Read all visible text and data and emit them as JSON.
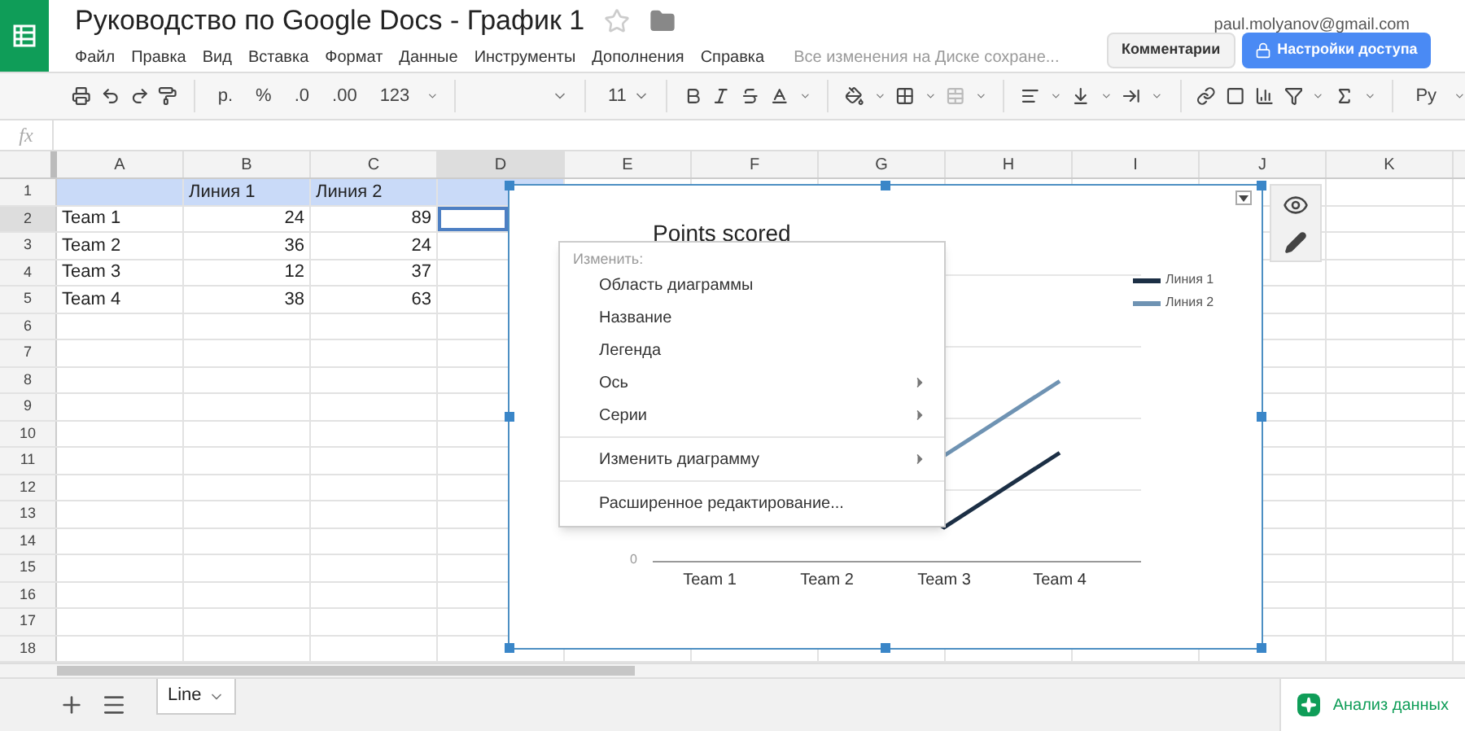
{
  "header": {
    "title": "Руководство по Google Docs - График 1",
    "account": "paul.molyanov@gmail.com",
    "save_status": "Все изменения на Диске сохране...",
    "comments_button": "Комментарии",
    "share_button": "Настройки доступа"
  },
  "menu": [
    "Файл",
    "Правка",
    "Вид",
    "Вставка",
    "Формат",
    "Данные",
    "Инструменты",
    "Дополнения",
    "Справка"
  ],
  "toolbar": {
    "currency": "р.",
    "percent": "%",
    "decrease_decimals": ".0",
    "increase_decimals": ".00",
    "more_formats": "123",
    "font_size": "11",
    "input_tools": "Ру"
  },
  "formula_bar": {
    "label": "fx"
  },
  "sheet": {
    "columns": [
      {
        "label": "A",
        "selected": false
      },
      {
        "label": "B",
        "selected": false
      },
      {
        "label": "C",
        "selected": false
      },
      {
        "label": "D",
        "selected": true
      },
      {
        "label": "E",
        "selected": false
      },
      {
        "label": "F",
        "selected": false
      },
      {
        "label": "G",
        "selected": false
      },
      {
        "label": "H",
        "selected": false
      },
      {
        "label": "I",
        "selected": false
      },
      {
        "label": "J",
        "selected": false
      },
      {
        "label": "K",
        "selected": false
      }
    ],
    "rows": [
      {
        "number": "1",
        "selected": false,
        "highlight": true,
        "cells": {
          "b": "Линия 1",
          "c": "Линия 2"
        }
      },
      {
        "number": "2",
        "selected": true,
        "highlight": false,
        "cells": {
          "a": "Team 1",
          "b": "24",
          "c": "89"
        }
      },
      {
        "number": "3",
        "selected": false,
        "highlight": false,
        "cells": {
          "a": "Team 2",
          "b": "36",
          "c": "24"
        }
      },
      {
        "number": "4",
        "selected": false,
        "highlight": false,
        "cells": {
          "a": "Team 3",
          "b": "12",
          "c": "37"
        }
      },
      {
        "number": "5",
        "selected": false,
        "highlight": false,
        "cells": {
          "a": "Team 4",
          "b": "38",
          "c": "63"
        }
      },
      {
        "number": "6",
        "selected": false,
        "highlight": false
      },
      {
        "number": "7",
        "selected": false,
        "highlight": false
      },
      {
        "number": "8",
        "selected": false,
        "highlight": false
      },
      {
        "number": "9",
        "selected": false,
        "highlight": false
      },
      {
        "number": "10",
        "selected": false,
        "highlight": false
      },
      {
        "number": "11",
        "selected": false,
        "highlight": false
      },
      {
        "number": "12",
        "selected": false,
        "highlight": false
      },
      {
        "number": "13",
        "selected": false,
        "highlight": false
      },
      {
        "number": "14",
        "selected": false,
        "highlight": false
      },
      {
        "number": "15",
        "selected": false,
        "highlight": false
      },
      {
        "number": "16",
        "selected": false,
        "highlight": false
      },
      {
        "number": "17",
        "selected": false,
        "highlight": false
      },
      {
        "number": "18",
        "selected": false,
        "highlight": false
      }
    ]
  },
  "chart": {
    "title": "Points scored",
    "legend": [
      {
        "label": "Линия 1",
        "color": "#1c2f45"
      },
      {
        "label": "Линия 2",
        "color": "#6f93b3"
      }
    ],
    "categories": [
      "Team 1",
      "Team 2",
      "Team 3",
      "Team 4"
    ],
    "y_tick": "0"
  },
  "context_menu": {
    "heading": "Изменить:",
    "groups": [
      [
        {
          "label": "Область диаграммы",
          "submenu": false
        },
        {
          "label": "Название",
          "submenu": false
        },
        {
          "label": "Легенда",
          "submenu": false
        },
        {
          "label": "Ось",
          "submenu": true
        },
        {
          "label": "Серии",
          "submenu": true
        }
      ],
      [
        {
          "label": "Изменить диаграмму",
          "submenu": true
        }
      ],
      [
        {
          "label": "Расширенное редактирование...",
          "submenu": false
        }
      ]
    ]
  },
  "sheet_tabs": [
    {
      "label": "Line",
      "selected": true
    }
  ],
  "explore_button": "Анализ данных"
}
